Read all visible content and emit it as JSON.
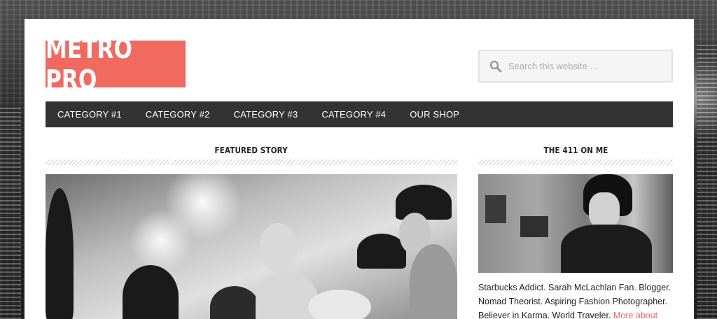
{
  "site": {
    "logo_text": "METRO PRO",
    "brand_color": "#f06a60"
  },
  "search": {
    "placeholder": "Search this website …",
    "icon": "search-icon"
  },
  "nav": {
    "items": [
      {
        "label": "CATEGORY #1"
      },
      {
        "label": "CATEGORY #2"
      },
      {
        "label": "CATEGORY #3"
      },
      {
        "label": "CATEGORY #4"
      },
      {
        "label": "OUR SHOP"
      }
    ]
  },
  "featured": {
    "title": "FEATURED STORY"
  },
  "sidebar": {
    "title": "THE 411 ON ME",
    "about_text": "Starbucks Addict. Sarah McLachlan Fan. Blogger. Nomad Theorist. Aspiring Fashion Photographer. Believer in Karma. World Traveler.",
    "more_link": "More about"
  }
}
